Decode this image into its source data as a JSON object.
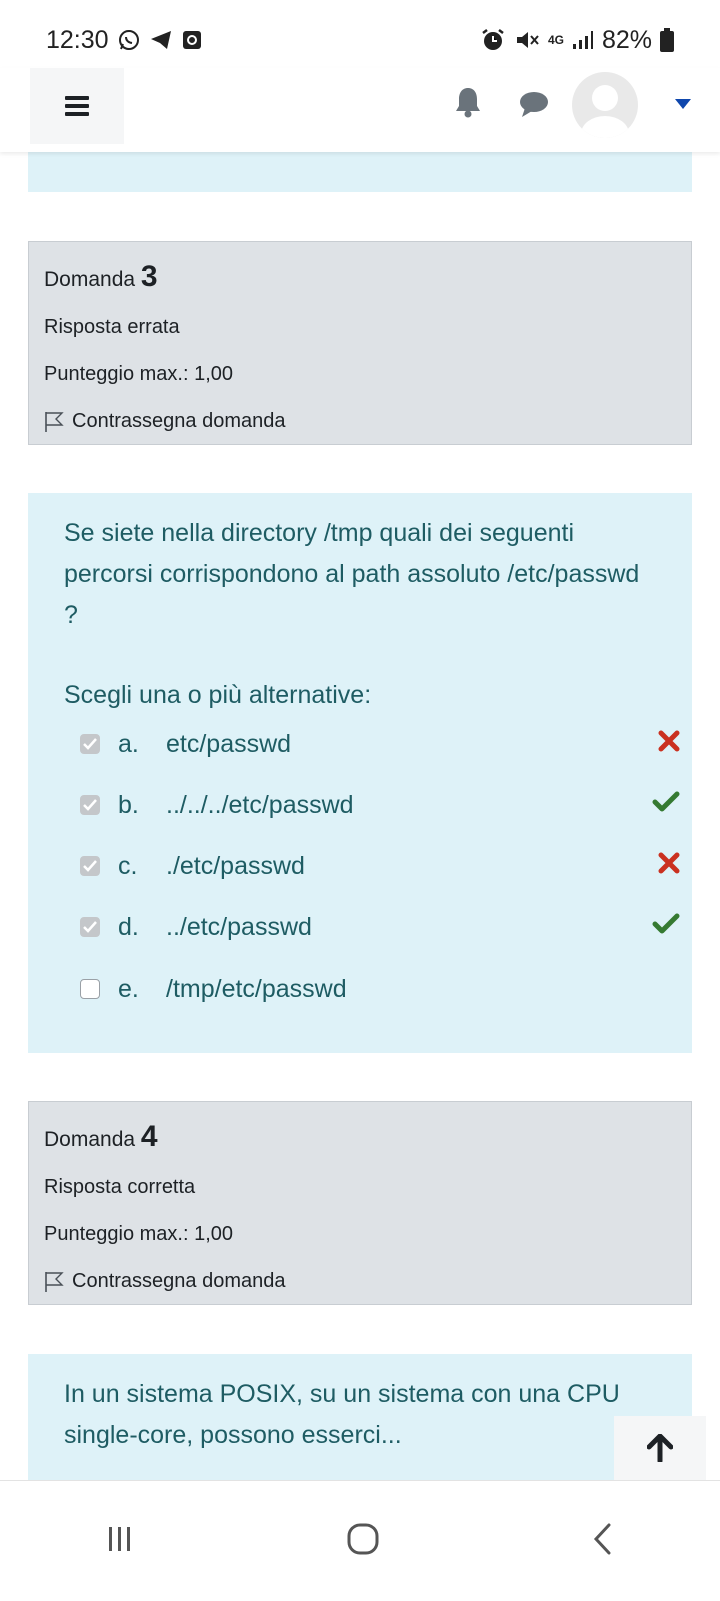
{
  "statusbar": {
    "time": "12:30",
    "network": "4G",
    "battery": "82%"
  },
  "questions": [
    {
      "label": "Domanda",
      "number": "3",
      "state": "Risposta errata",
      "grade": "Punteggio max.: 1,00",
      "flag": "Contrassegna domanda",
      "text": "Se siete nella directory /tmp quali dei seguenti percorsi corrispondono al path assoluto /etc/passwd ?",
      "prompt": "Scegli una o più alternative:",
      "options": [
        {
          "letter": "a.",
          "text": "etc/passwd",
          "checked": true,
          "result": "incorrect"
        },
        {
          "letter": "b.",
          "text": "../../../etc/passwd",
          "checked": true,
          "result": "correct"
        },
        {
          "letter": "c.",
          "text": "./etc/passwd",
          "checked": true,
          "result": "incorrect"
        },
        {
          "letter": "d.",
          "text": "../etc/passwd",
          "checked": true,
          "result": "correct"
        },
        {
          "letter": "e.",
          "text": "/tmp/etc/passwd",
          "checked": false,
          "result": "none"
        }
      ]
    },
    {
      "label": "Domanda",
      "number": "4",
      "state": "Risposta corretta",
      "grade": "Punteggio max.: 1,00",
      "flag": "Contrassegna domanda",
      "text": "In un sistema POSIX, su un sistema con una CPU single-core, possono esserci..."
    }
  ],
  "colors": {
    "info_bg": "#def2f8",
    "question_text": "#1e5c63",
    "correct": "#357a32",
    "incorrect": "#ca3120",
    "nav_caret": "#0f47ad"
  },
  "icons": {
    "menu": "hamburger-icon",
    "notifications": "bell-icon",
    "messages": "chat-bubble-icon",
    "user": "avatar-icon",
    "flag": "flag-icon",
    "correct": "check-icon",
    "incorrect": "cross-icon",
    "scroll_top": "arrow-up-icon"
  }
}
